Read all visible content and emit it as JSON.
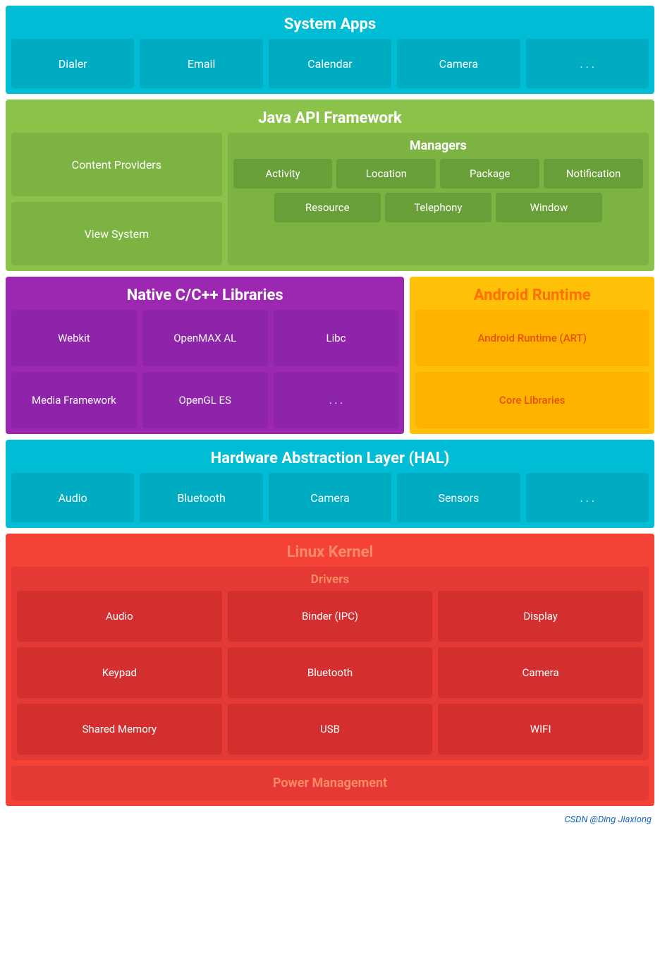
{
  "systemApps": {
    "title": "System Apps",
    "cells": [
      "Dialer",
      "Email",
      "Calendar",
      "Camera",
      ". . ."
    ]
  },
  "javaApi": {
    "title": "Java API Framework",
    "left": [
      "Content Providers",
      "View System"
    ],
    "managers": {
      "title": "Managers",
      "row1": [
        "Activity",
        "Location",
        "Package",
        "Notification"
      ],
      "row2": [
        "Resource",
        "Telephony",
        "Window"
      ]
    }
  },
  "nativeLibs": {
    "title": "Native C/C++ Libraries",
    "cells": [
      "Webkit",
      "OpenMAX AL",
      "Libc",
      "Media Framework",
      "OpenGL ES",
      ". . ."
    ]
  },
  "androidRuntime": {
    "title": "Android Runtime",
    "cells": [
      "Android Runtime (ART)",
      "Core Libraries"
    ]
  },
  "hal": {
    "title": "Hardware Abstraction Layer (HAL)",
    "cells": [
      "Audio",
      "Bluetooth",
      "Camera",
      "Sensors",
      ". . ."
    ]
  },
  "linuxKernel": {
    "title": "Linux Kernel",
    "drivers": {
      "title": "Drivers",
      "cells": [
        "Audio",
        "Binder (IPC)",
        "Display",
        "Keypad",
        "Bluetooth",
        "Camera",
        "Shared Memory",
        "USB",
        "WIFI"
      ]
    },
    "powerMgmt": "Power Management"
  },
  "watermark": "CSDN @Ding Jiaxiong"
}
